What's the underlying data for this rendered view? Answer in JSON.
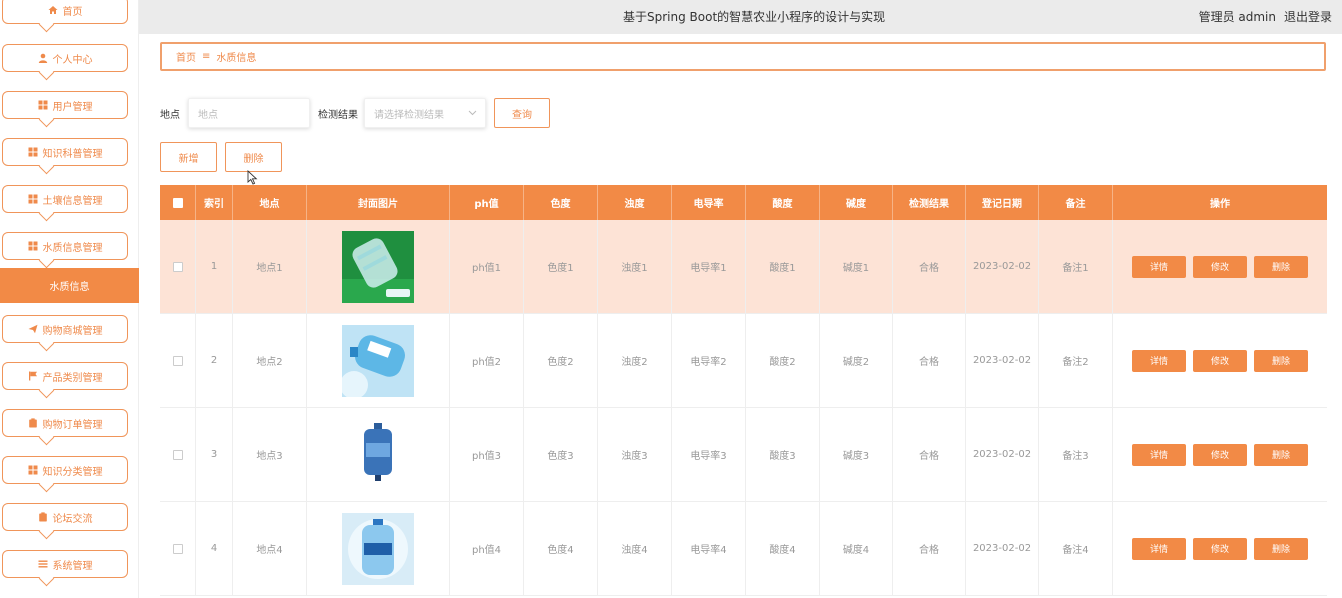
{
  "header": {
    "title": "基于Spring Boot的智慧农业小程序的设计与实现",
    "user": "管理员 admin",
    "logout": "退出登录"
  },
  "sidebar": {
    "items": [
      {
        "label": "首页",
        "icon": "home-icon"
      },
      {
        "label": "个人中心",
        "icon": "user-icon"
      },
      {
        "label": "用户管理",
        "icon": "grid-icon"
      },
      {
        "label": "知识科普管理",
        "icon": "grid-icon"
      },
      {
        "label": "土壤信息管理",
        "icon": "grid-icon"
      },
      {
        "label": "水质信息管理",
        "icon": "grid-icon"
      },
      {
        "label": "购物商城管理",
        "icon": "send-icon"
      },
      {
        "label": "产品类别管理",
        "icon": "flag-icon"
      },
      {
        "label": "购物订单管理",
        "icon": "clipboard-icon"
      },
      {
        "label": "知识分类管理",
        "icon": "grid-icon"
      },
      {
        "label": "论坛交流",
        "icon": "clipboard-icon"
      },
      {
        "label": "系统管理",
        "icon": "list-icon"
      }
    ],
    "active_sub": "水质信息"
  },
  "breadcrumb": {
    "home": "首页",
    "sep": "≡",
    "current": "水质信息"
  },
  "search": {
    "location_label": "地点",
    "location_placeholder": "地点",
    "result_label": "检测结果",
    "result_placeholder": "请选择检测结果",
    "query_button": "查询"
  },
  "actions": {
    "add": "新增",
    "delete": "删除"
  },
  "table": {
    "columns": [
      "索引",
      "地点",
      "封面图片",
      "ph值",
      "色度",
      "浊度",
      "电导率",
      "酸度",
      "碱度",
      "检测结果",
      "登记日期",
      "备注",
      "操作"
    ],
    "row_buttons": {
      "detail": "详情",
      "edit": "修改",
      "delete": "删除"
    },
    "rows": [
      {
        "index": "1",
        "location": "地点1",
        "ph": "ph值1",
        "color": "色度1",
        "turbidity": "浊度1",
        "conductivity": "电导率1",
        "acidity": "酸度1",
        "alkalinity": "碱度1",
        "result": "合格",
        "date": "2023-02-02",
        "note": "备注1"
      },
      {
        "index": "2",
        "location": "地点2",
        "ph": "ph值2",
        "color": "色度2",
        "turbidity": "浊度2",
        "conductivity": "电导率2",
        "acidity": "酸度2",
        "alkalinity": "碱度2",
        "result": "合格",
        "date": "2023-02-02",
        "note": "备注2"
      },
      {
        "index": "3",
        "location": "地点3",
        "ph": "ph值3",
        "color": "色度3",
        "turbidity": "浊度3",
        "conductivity": "电导率3",
        "acidity": "酸度3",
        "alkalinity": "碱度3",
        "result": "合格",
        "date": "2023-02-02",
        "note": "备注3"
      },
      {
        "index": "4",
        "location": "地点4",
        "ph": "ph值4",
        "color": "色度4",
        "turbidity": "浊度4",
        "conductivity": "电导率4",
        "acidity": "酸度4",
        "alkalinity": "碱度4",
        "result": "合格",
        "date": "2023-02-02",
        "note": "备注4"
      }
    ]
  },
  "colors": {
    "accent": "#f28a46",
    "row_highlight": "#fde3d6"
  }
}
